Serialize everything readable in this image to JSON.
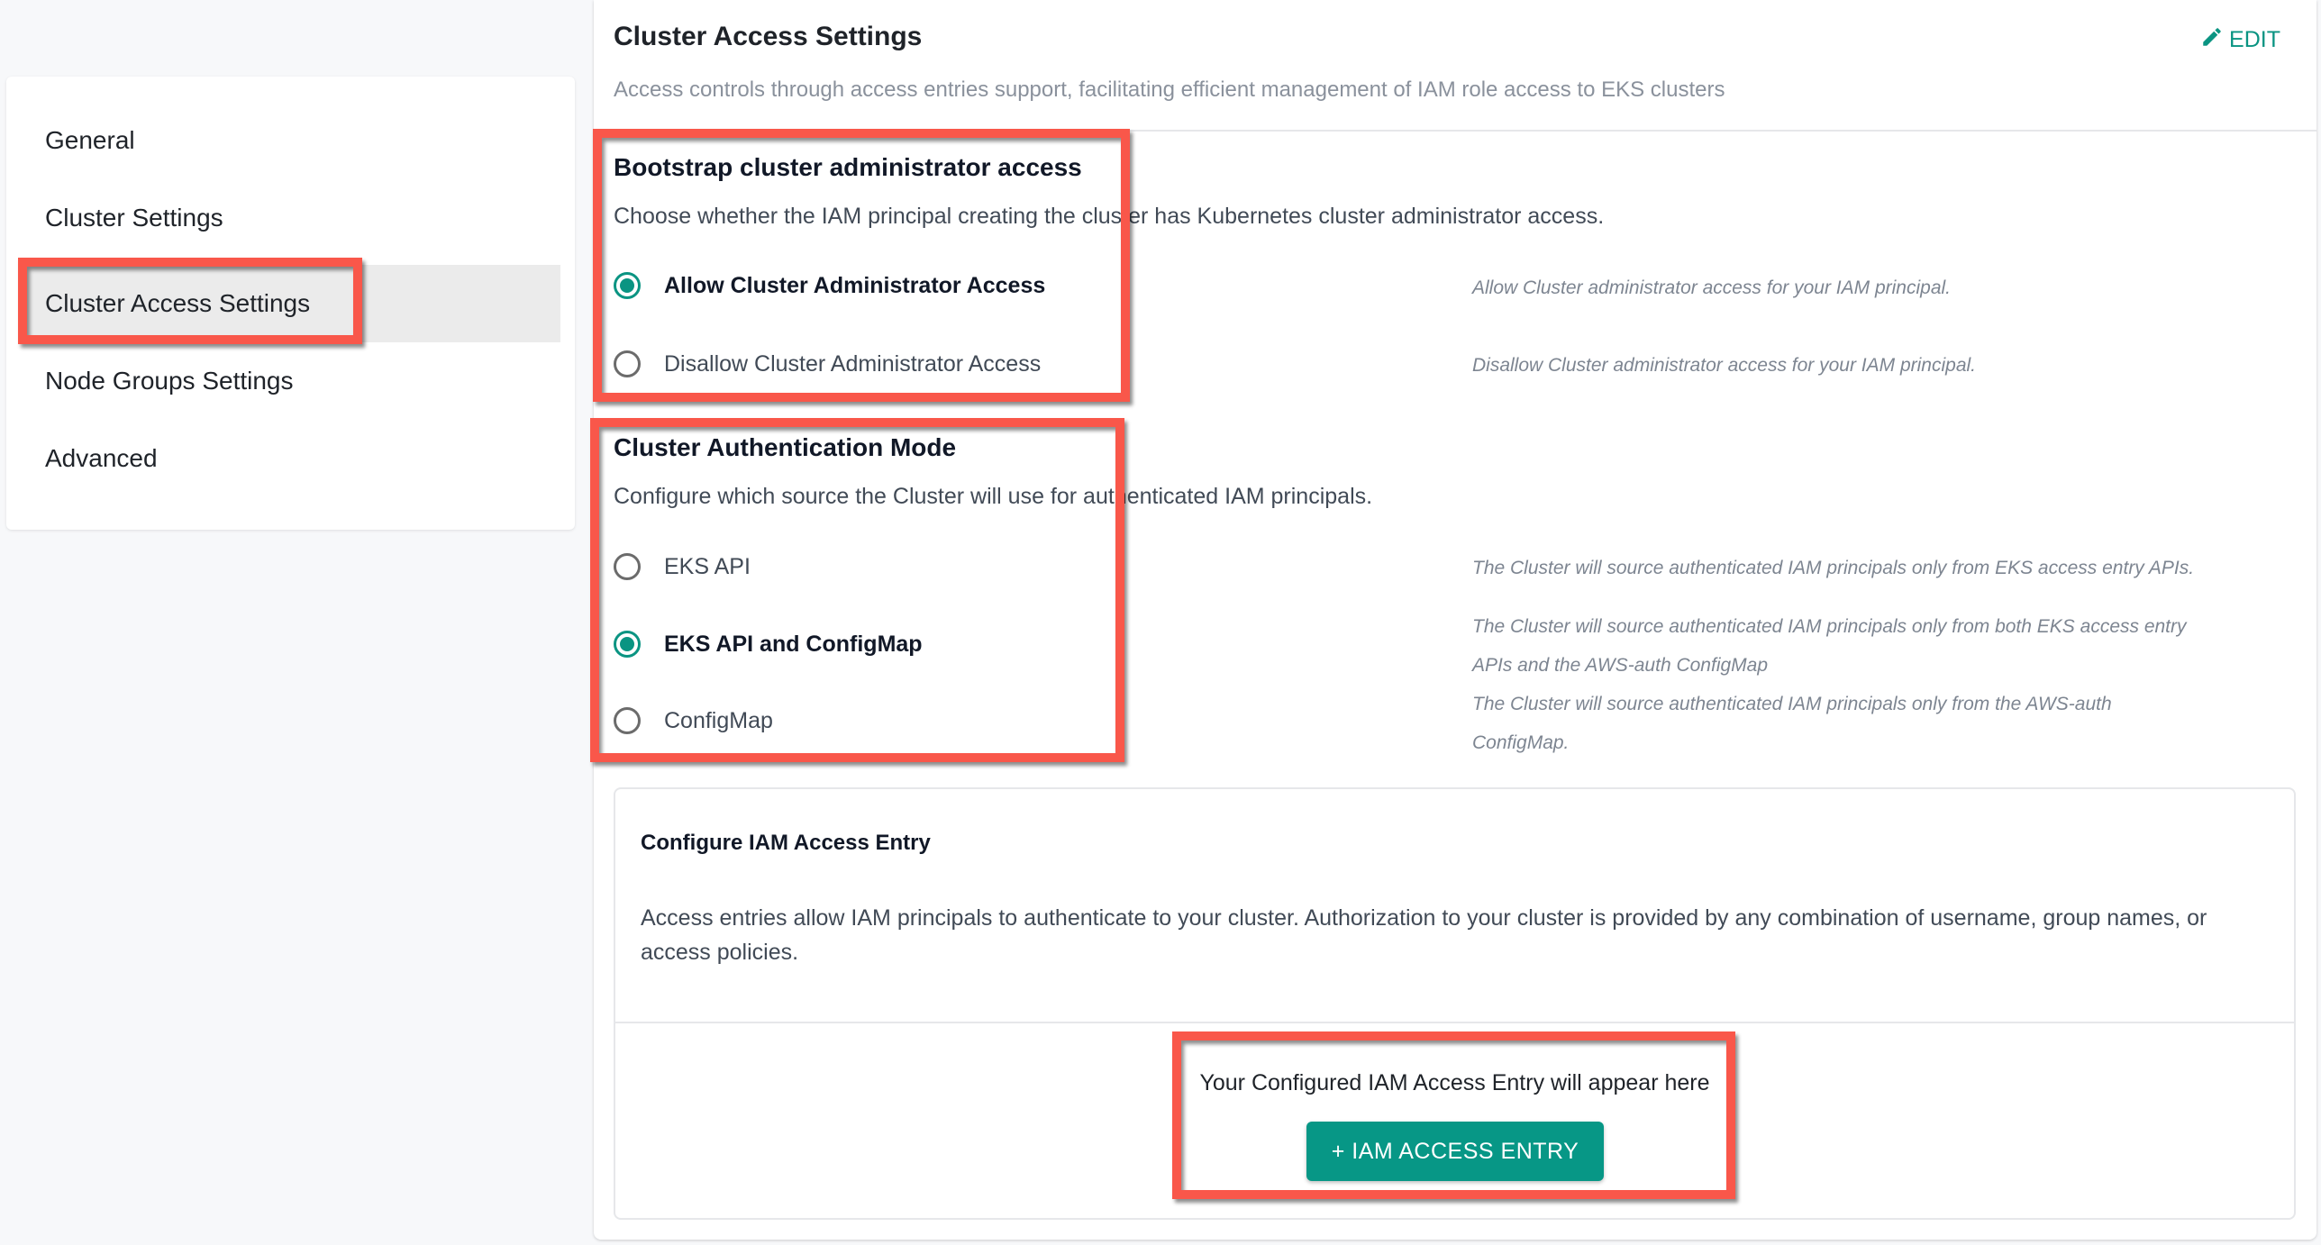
{
  "sidebar": {
    "items": [
      {
        "label": "General",
        "active": false
      },
      {
        "label": "Cluster Settings",
        "active": false
      },
      {
        "label": "Cluster Access Settings",
        "active": true
      },
      {
        "label": "Node Groups Settings",
        "active": false
      },
      {
        "label": "Advanced",
        "active": false
      }
    ]
  },
  "header": {
    "title": "Cluster Access Settings",
    "subtitle": "Access controls through access entries support, facilitating efficient management of IAM role access to EKS clusters",
    "edit_label": "EDIT",
    "edit_icon": "pencil-icon"
  },
  "bootstrap": {
    "heading": "Bootstrap cluster administrator access",
    "description": "Choose whether the IAM principal creating the cluster has Kubernetes cluster administrator access.",
    "options": [
      {
        "label": "Allow Cluster Administrator Access",
        "hint": "Allow Cluster administrator access for your IAM principal.",
        "selected": true
      },
      {
        "label": "Disallow Cluster Administrator Access",
        "hint": "Disallow Cluster administrator access for your IAM principal.",
        "selected": false
      }
    ]
  },
  "auth_mode": {
    "heading": "Cluster Authentication Mode",
    "description": "Configure which source the Cluster will use for authenticated IAM principals.",
    "options": [
      {
        "label": "EKS API",
        "hint": "The Cluster will source authenticated IAM principals only from EKS access entry APIs.",
        "selected": false
      },
      {
        "label": "EKS API and ConfigMap",
        "hint": "The Cluster will source authenticated IAM principals only from both EKS access entry APIs and the AWS-auth ConfigMap",
        "selected": true
      },
      {
        "label": "ConfigMap",
        "hint": "The Cluster will source authenticated IAM principals only from the AWS-auth ConfigMap.",
        "selected": false
      }
    ]
  },
  "iam_access_entry": {
    "title": "Configure IAM Access Entry",
    "description": "Access entries allow IAM principals to authenticate to your cluster. Authorization to your cluster is provided by any combination of username, group names, or access policies.",
    "empty_text": "Your Configured IAM Access Entry will appear here",
    "add_button_label": "+ IAM ACCESS ENTRY"
  },
  "colors": {
    "accent": "#0a9482",
    "annotation": "#f9574a",
    "active_nav_bg": "#ebebeb"
  }
}
